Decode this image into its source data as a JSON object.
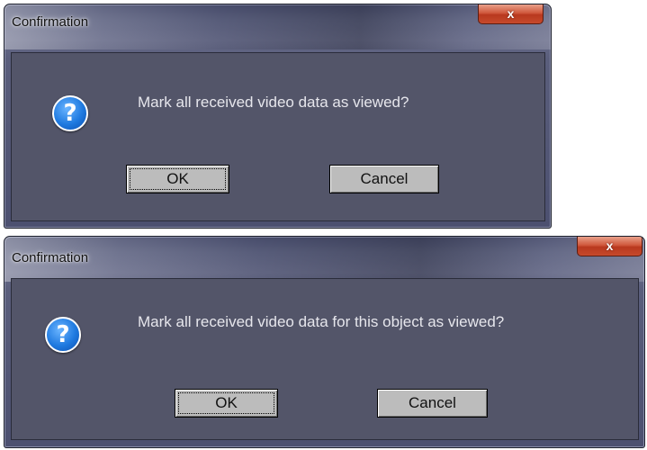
{
  "dialogs": [
    {
      "title": "Confirmation",
      "close_glyph": "x",
      "icon": "question-icon",
      "message": "Mark all received video data as viewed?",
      "ok_label": "OK",
      "cancel_label": "Cancel"
    },
    {
      "title": "Confirmation",
      "close_glyph": "x",
      "icon": "question-icon",
      "message": "Mark all received video data for this object as viewed?",
      "ok_label": "OK",
      "cancel_label": "Cancel"
    }
  ],
  "colors": {
    "client_background": "#535569",
    "button_face": "#bcbcbc",
    "close_button": "#c64a2c",
    "icon_blue": "#1f7ae0",
    "message_text": "#e6e6ec"
  }
}
